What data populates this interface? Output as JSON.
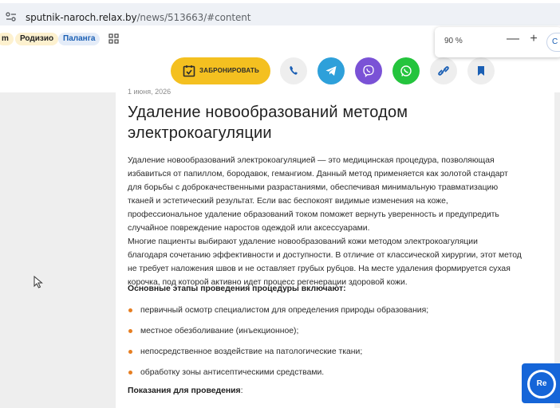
{
  "browser": {
    "url_host": "sputnik-naroch.relax.by",
    "url_path": "/news/513663/#content",
    "zoom_value": "90 %",
    "zoom_minus": "—",
    "zoom_plus": "+",
    "zoom_reset_partial": "C"
  },
  "bookmarks": {
    "items": [
      "m",
      "Родизио",
      "Паланга"
    ]
  },
  "actions": {
    "book_label": "ЗАБРОНИРОВАТЬ",
    "icons": [
      "phone-icon",
      "telegram-icon",
      "viber-icon",
      "whatsapp-icon",
      "link-icon",
      "bookmark-icon"
    ]
  },
  "article": {
    "date": "1 июня, 2026",
    "title": "Удаление новообразований методом электрокоагуляции",
    "lines": [
      "Удаление новообразований электрокоагуляцией — это медицинская процедура, позволяющая",
      "избавиться от папиллом, бородавок, гемангиом. Данный метод применяется как золотой стандарт",
      "для борьбы с доброкачественными разрастаниями, обеспечивая минимальную травматизацию",
      "тканей и эстетический результат. Если вас беспокоят видимые изменения на коже,",
      "профессиональное удаление образований током поможет вернуть уверенность и предупредить",
      "случайное повреждение наростов одеждой или аксессуарами.",
      "Многие пациенты выбирают удаление новообразований кожи методом электрокоагуляции",
      "благодаря сочетанию эффективности и доступности. В отличие от классической хирургии, этот метод",
      "не требует наложения швов и не оставляет грубых рубцов. На месте удаления формируется сухая",
      "корочка, под которой активно идет процесс регенерации здоровой кожи."
    ],
    "section_heading": "Основные этапы проведения процедуры включают:",
    "bullets": [
      "первичный осмотр специалистом для определения природы образования;",
      "местное обезболивание (инъекционное);",
      "непосредственное воздействие на патологические ткани;",
      "обработку зоны антисептическими средствами."
    ],
    "indications_bold": "Показания для проведения",
    "indications_tail": ":"
  },
  "widget": {
    "label": "Re"
  },
  "colors": {
    "accent_yellow": "#f4c020",
    "telegram": "#2ea0da",
    "viber": "#7a52d6",
    "whatsapp": "#24c43d",
    "bullet": "#e67e22",
    "widget_blue": "#1565d8"
  }
}
